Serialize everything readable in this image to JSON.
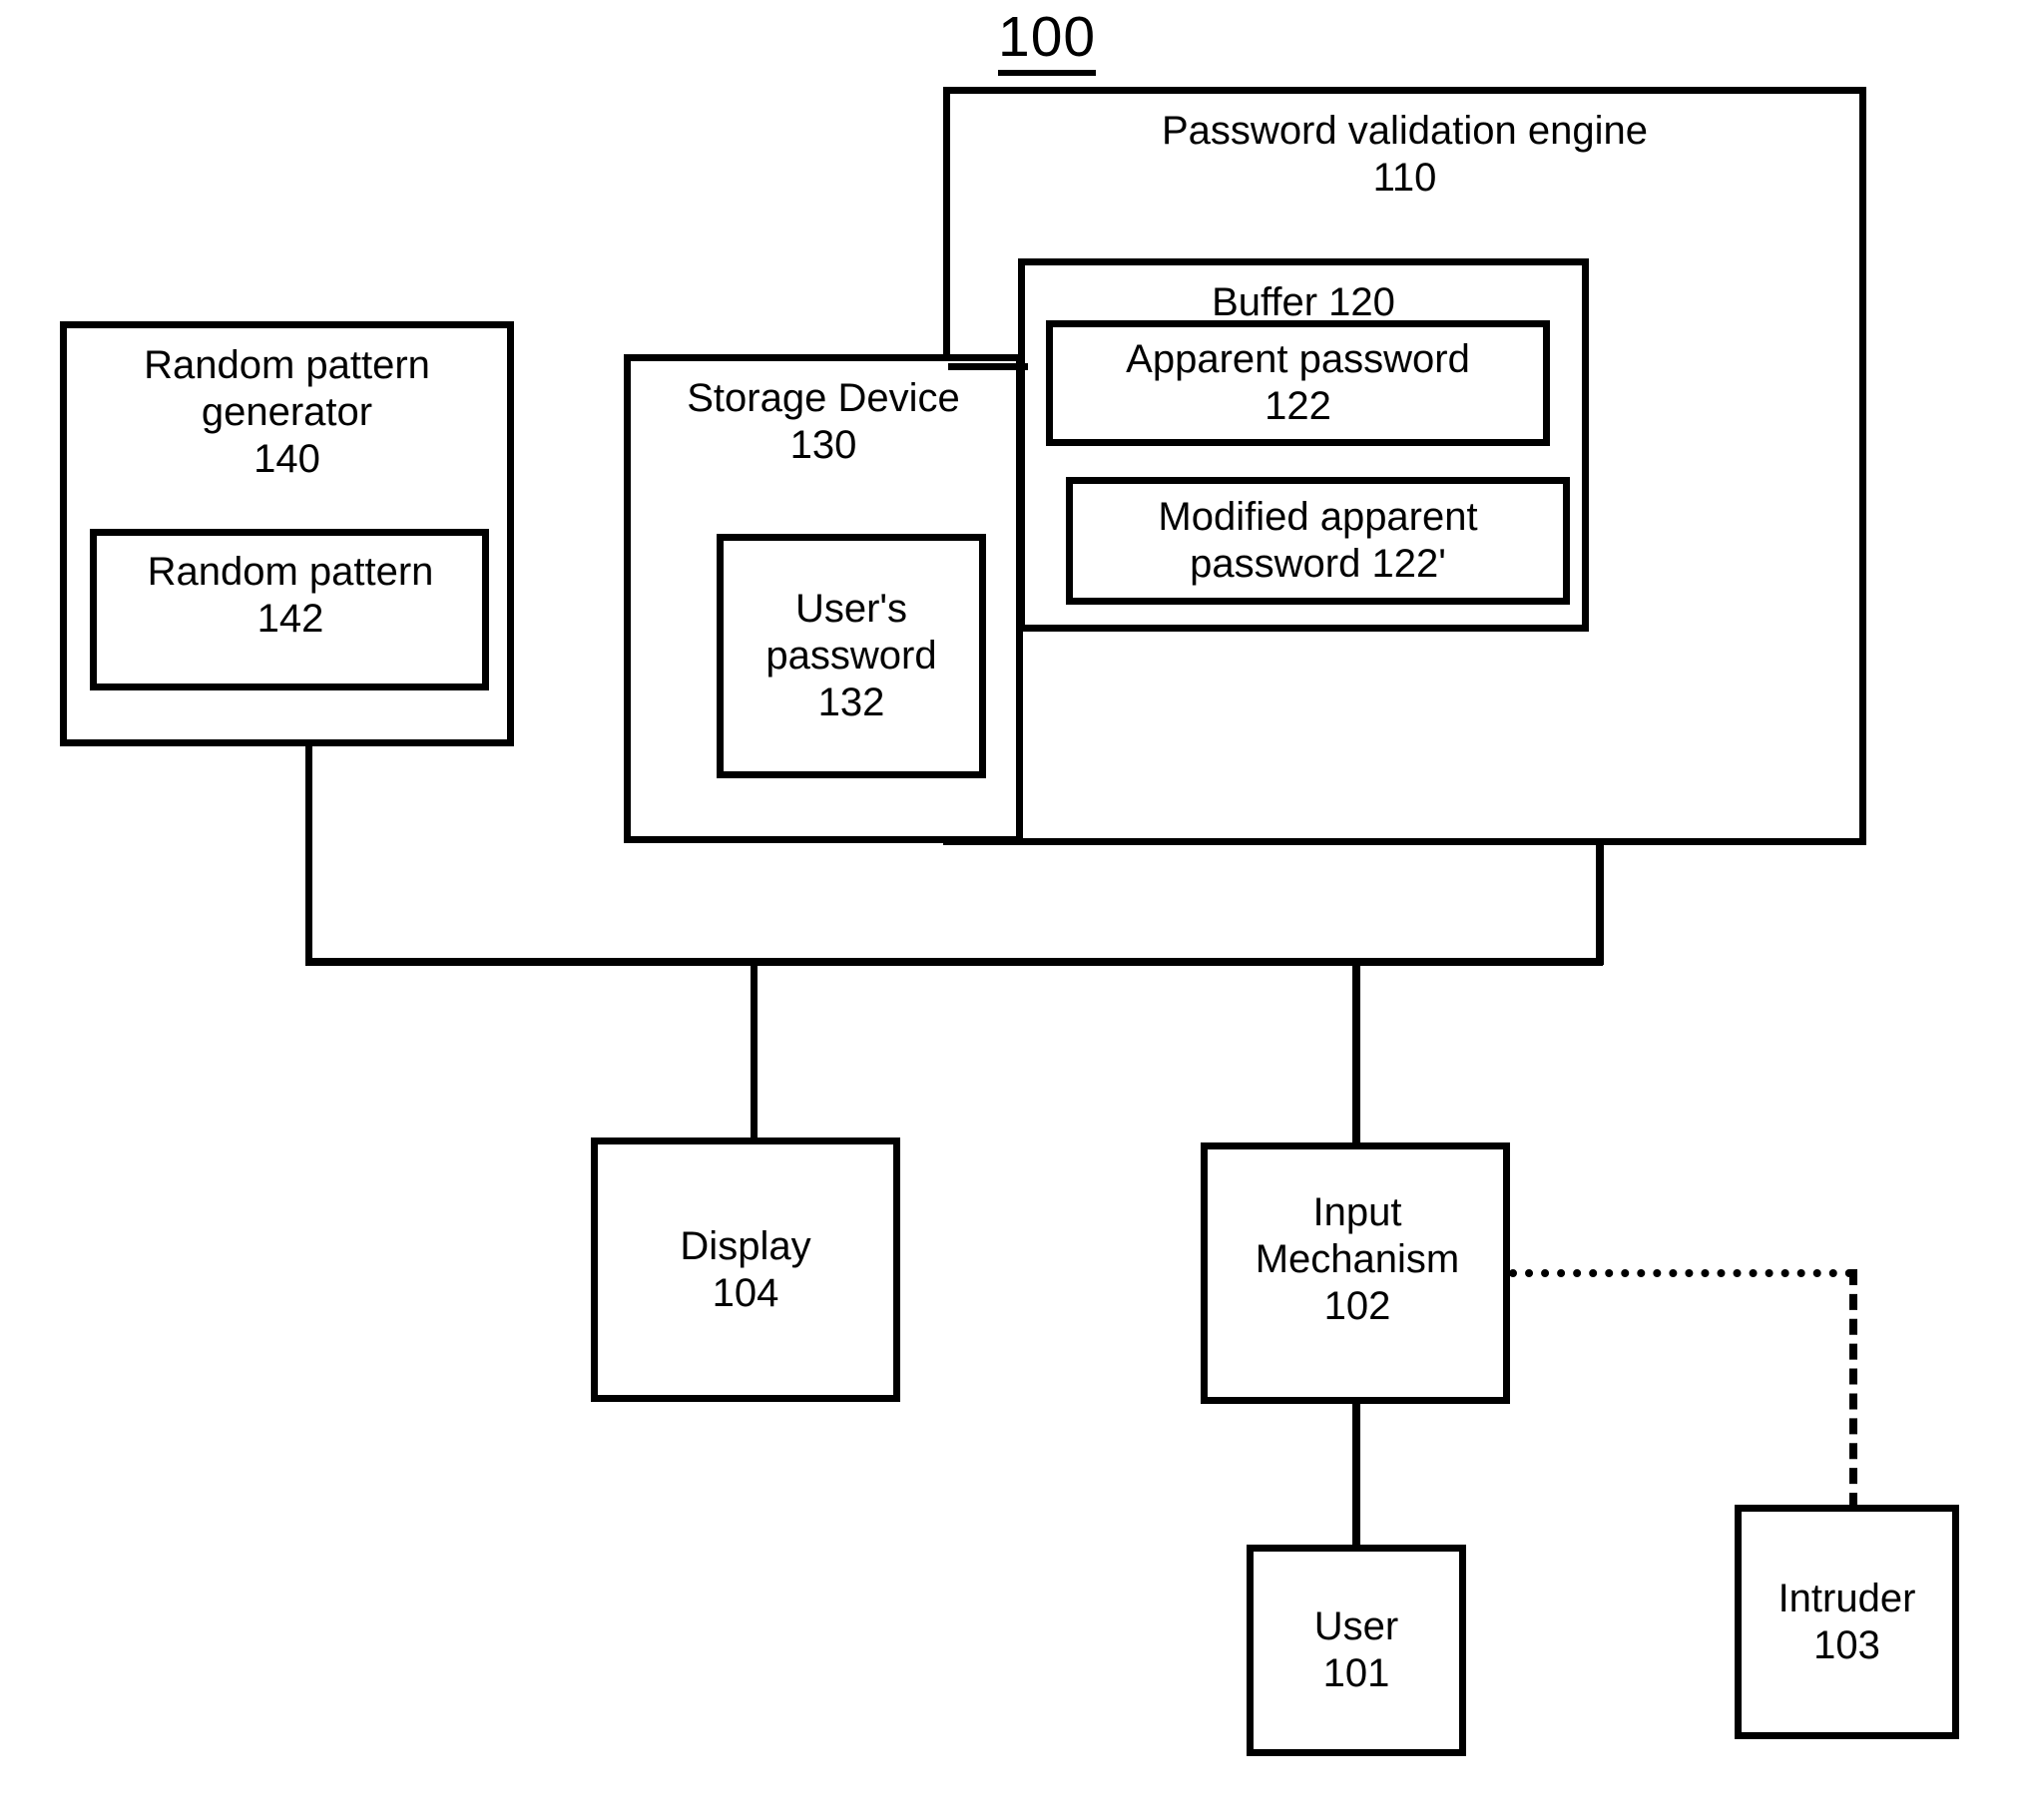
{
  "figure": {
    "number": "100"
  },
  "blocks": {
    "password_validation_engine": {
      "label": "Password validation engine\n110",
      "name": "Password validation engine",
      "ref": "110"
    },
    "buffer": {
      "label": "Buffer 120",
      "name": "Buffer",
      "ref": "120"
    },
    "apparent_password": {
      "label": "Apparent password\n122",
      "name": "Apparent password",
      "ref": "122"
    },
    "modified_apparent_password": {
      "label": "Modified apparent\npassword 122'",
      "name": "Modified apparent password",
      "ref": "122'"
    },
    "random_pattern_generator": {
      "label": "Random pattern\ngenerator\n140",
      "name": "Random pattern generator",
      "ref": "140"
    },
    "random_pattern": {
      "label": "Random pattern\n142",
      "name": "Random pattern",
      "ref": "142"
    },
    "storage_device": {
      "label": "Storage Device\n130",
      "name": "Storage Device",
      "ref": "130"
    },
    "users_password": {
      "label": "User's\npassword\n132",
      "name": "User's password",
      "ref": "132"
    },
    "display": {
      "label": "Display\n104",
      "name": "Display",
      "ref": "104"
    },
    "input_mechanism": {
      "label": "Input\nMechanism\n102",
      "name": "Input Mechanism",
      "ref": "102"
    },
    "user": {
      "label": "User\n101",
      "name": "User",
      "ref": "101"
    },
    "intruder": {
      "label": "Intruder\n103",
      "name": "Intruder",
      "ref": "103"
    }
  },
  "connections": [
    {
      "from": "Storage Device 130",
      "to": "Password validation engine 110",
      "style": "solid"
    },
    {
      "from": "Random pattern generator 140",
      "to": "system bus",
      "style": "solid"
    },
    {
      "from": "Password validation engine 110",
      "to": "system bus",
      "style": "solid"
    },
    {
      "from": "system bus",
      "to": "Display 104",
      "style": "solid"
    },
    {
      "from": "system bus",
      "to": "Input Mechanism 102",
      "style": "solid"
    },
    {
      "from": "Input Mechanism 102",
      "to": "User 101",
      "style": "solid"
    },
    {
      "from": "Input Mechanism 102",
      "to": "Intruder 103",
      "style": "dashed"
    }
  ],
  "colors": {
    "stroke": "#000000",
    "background": "#ffffff"
  }
}
